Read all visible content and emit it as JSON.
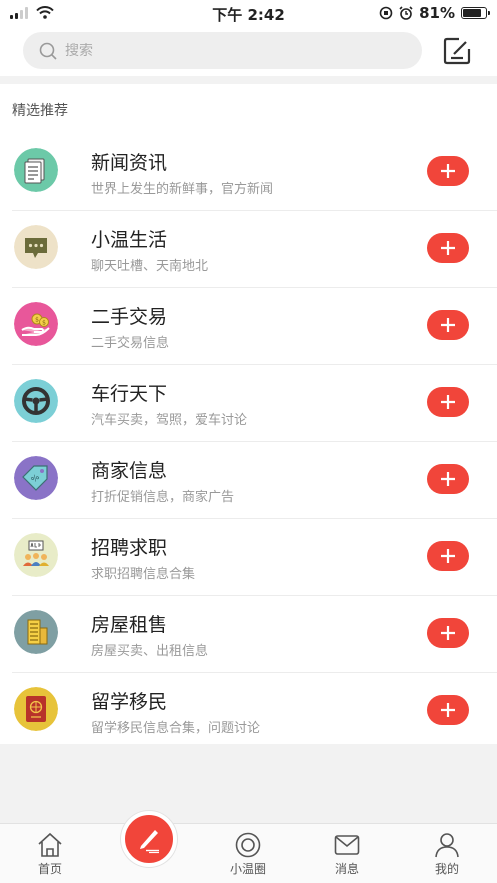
{
  "status_bar": {
    "time": "下午 2:42",
    "battery": "81%",
    "battery_level": 0.81
  },
  "search": {
    "placeholder": "搜索"
  },
  "section": {
    "title": "精选推荐"
  },
  "categories": [
    {
      "title": "新闻资讯",
      "desc": "世界上发生的新鲜事，官方新闻",
      "icon": "newspaper-icon",
      "color": "#6cc9a8"
    },
    {
      "title": "小温生活",
      "desc": "聊天吐槽、天南地北",
      "icon": "chat-bubble-icon",
      "color": "#eee2c8"
    },
    {
      "title": "二手交易",
      "desc": "二手交易信息",
      "icon": "money-hand-icon",
      "color": "#e8579a"
    },
    {
      "title": "车行天下",
      "desc": "汽车买卖，驾照，爱车讨论",
      "icon": "steering-wheel-icon",
      "color": "#7ccfd6"
    },
    {
      "title": "商家信息",
      "desc": "打折促销信息，商家广告",
      "icon": "price-tag-icon",
      "color": "#8a73c7"
    },
    {
      "title": "招聘求职",
      "desc": "求职招聘信息合集",
      "icon": "job-board-icon",
      "color": "#e8ecc8"
    },
    {
      "title": "房屋租售",
      "desc": "房屋买卖、出租信息",
      "icon": "building-icon",
      "color": "#7f9fa3"
    },
    {
      "title": "留学移民",
      "desc": "留学移民信息合集，问题讨论",
      "icon": "passport-icon",
      "color": "#e7c33a"
    }
  ],
  "tab_bar": {
    "home": "首页",
    "circle": "小温圈",
    "messages": "消息",
    "mine": "我的"
  },
  "colors": {
    "accent": "#f1453a"
  }
}
